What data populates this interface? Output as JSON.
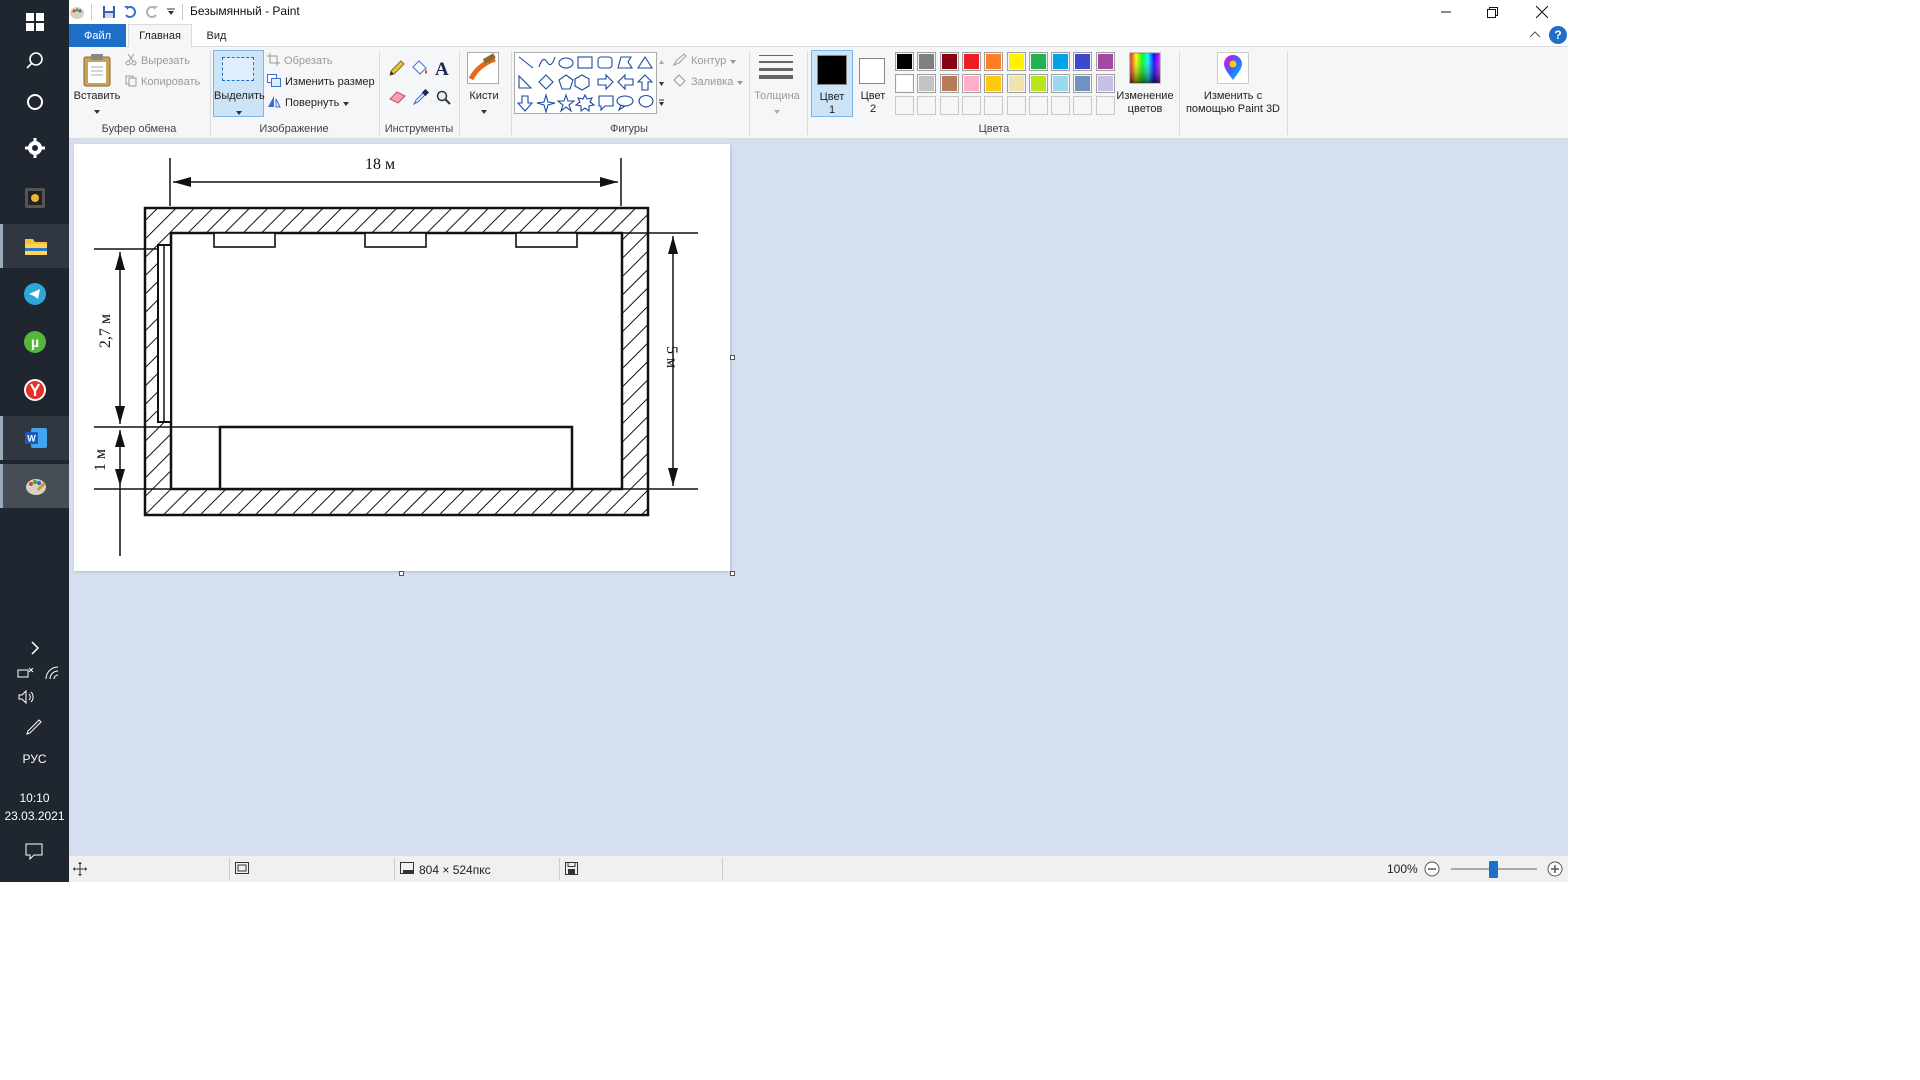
{
  "window": {
    "title": "Безымянный - Paint"
  },
  "menu": {
    "file": "Файл",
    "home": "Главная",
    "view": "Вид"
  },
  "ribbon": {
    "clipboard": {
      "group": "Буфер обмена",
      "paste": "Вставить",
      "cut": "Вырезать",
      "copy": "Копировать"
    },
    "image": {
      "group": "Изображение",
      "select": "Выделить",
      "crop": "Обрезать",
      "resize": "Изменить размер",
      "rotate": "Повернуть"
    },
    "tools": {
      "group": "Инструменты"
    },
    "brushes": "Кисти",
    "shapes": {
      "group": "Фигуры",
      "outline": "Контур",
      "fill": "Заливка"
    },
    "thickness": "Толщина",
    "colors": {
      "group": "Цвета",
      "color1_a": "Цвет",
      "color1_b": "1",
      "color2_a": "Цвет",
      "color2_b": "2",
      "edit_a": "Изменение",
      "edit_b": "цветов",
      "paint3d_a": "Изменить с",
      "paint3d_b": "помощью Paint 3D",
      "palette_row1": [
        "#000000",
        "#7f7f7f",
        "#880015",
        "#ed1c24",
        "#ff7f27",
        "#fff200",
        "#22b14c",
        "#00a2e8",
        "#3f48cc",
        "#a349a4"
      ],
      "palette_row2": [
        "#ffffff",
        "#c3c3c3",
        "#b97a57",
        "#ffaec9",
        "#ffc90e",
        "#efe4b0",
        "#b5e61d",
        "#99d9ea",
        "#7092be",
        "#c8bfe7"
      ]
    }
  },
  "drawing": {
    "width_label": "18 м",
    "height_label": "5 м",
    "upper_label": "2,7 м",
    "lower_label": "1 м"
  },
  "status": {
    "size": "804 × 524пкс",
    "zoom": "100%"
  },
  "taskbar": {
    "lang": "РУС",
    "time": "10:10",
    "date": "23.03.2021"
  }
}
